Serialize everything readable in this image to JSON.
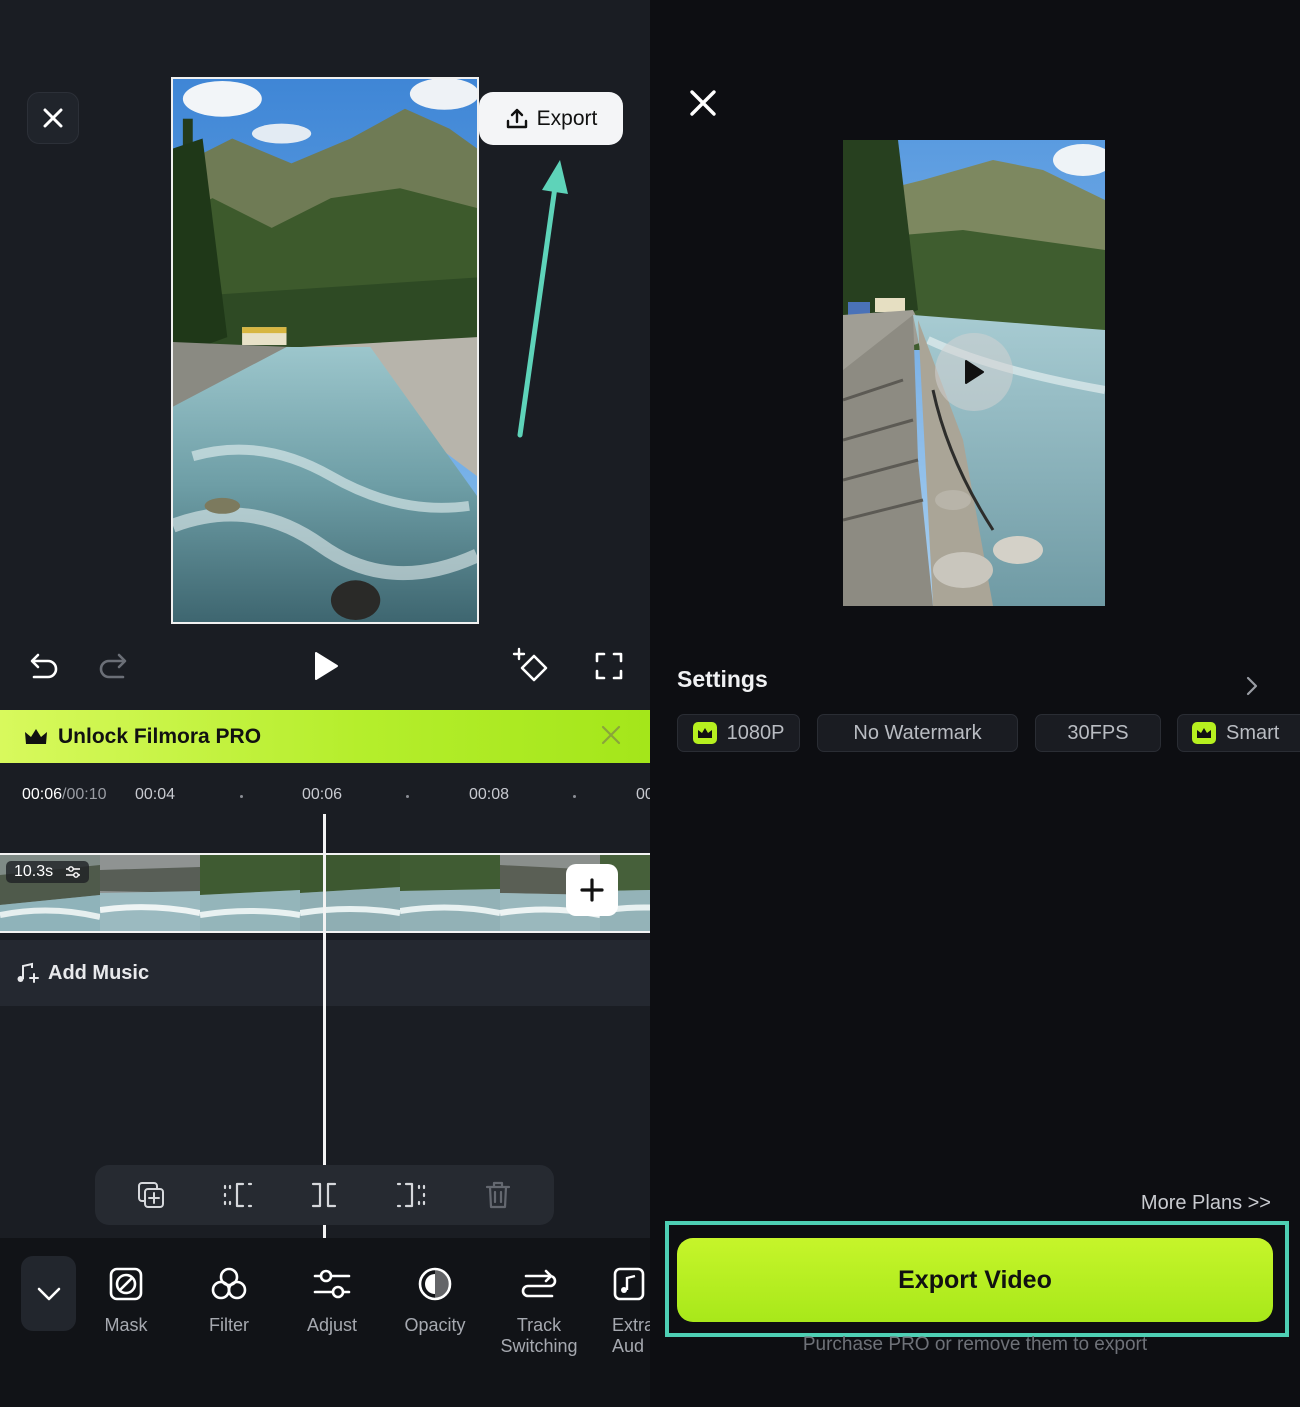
{
  "editor": {
    "export_label": "Export",
    "pro_banner": {
      "label": "Unlock Filmora PRO"
    },
    "timeline": {
      "current_time": "00:06",
      "total_time": "/00:10",
      "markers": [
        "00:04",
        "00:06",
        "00:08",
        "00"
      ],
      "clip_duration": "10.3s",
      "add_music_label": "Add Music"
    },
    "tools": [
      {
        "label": "Mask",
        "icon": "mask-icon"
      },
      {
        "label": "Filter",
        "icon": "filter-icon"
      },
      {
        "label": "Adjust",
        "icon": "adjust-icon"
      },
      {
        "label": "Opacity",
        "icon": "opacity-icon"
      },
      {
        "label": "Track\nSwitching",
        "icon": "track-switching-icon"
      },
      {
        "label": "Extra\nAud",
        "icon": "extract-audio-icon"
      }
    ]
  },
  "export_panel": {
    "settings_title": "Settings",
    "chips": [
      {
        "label": "1080P",
        "pro": true
      },
      {
        "label": "No Watermark",
        "pro": false
      },
      {
        "label": "30FPS",
        "pro": false
      },
      {
        "label": "Smart",
        "pro": true
      }
    ],
    "more_plans": "More Plans >>",
    "export_video_label": "Export Video",
    "purchase_note": "Purchase PRO or remove them to export"
  },
  "colors": {
    "accent_green": "#b5ee2c",
    "annotation_teal": "#4ecfb4",
    "background": "#1a1d23"
  }
}
